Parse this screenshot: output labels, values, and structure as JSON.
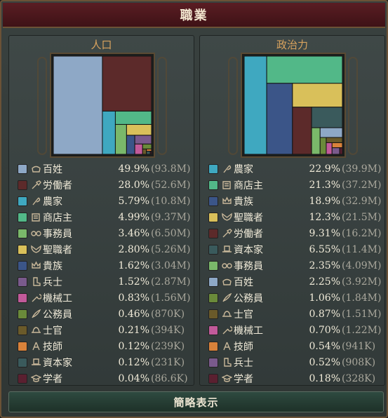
{
  "window": {
    "title": "職業"
  },
  "population": {
    "heading": "人口",
    "rows": [
      {
        "label": "百姓",
        "pct": "49.9%",
        "abs": "(93.8M)",
        "color": "#8ea8c6",
        "icon": "pot-icon"
      },
      {
        "label": "労働者",
        "pct": "28.0%",
        "abs": "(52.6M)",
        "color": "#5c2a2a",
        "icon": "shovel-icon"
      },
      {
        "label": "農家",
        "pct": "5.79%",
        "abs": "(10.8M)",
        "color": "#3fa8c0",
        "icon": "scythe-icon"
      },
      {
        "label": "商店主",
        "pct": "4.99%",
        "abs": "(9.37M)",
        "color": "#52b888",
        "icon": "ledger-icon"
      },
      {
        "label": "事務員",
        "pct": "3.46%",
        "abs": "(6.50M)",
        "color": "#7ab86a",
        "icon": "glasses-icon"
      },
      {
        "label": "聖職者",
        "pct": "2.80%",
        "abs": "(5.26M)",
        "color": "#d9c05a",
        "icon": "wings-icon"
      },
      {
        "label": "貴族",
        "pct": "1.62%",
        "abs": "(3.04M)",
        "color": "#3b5588",
        "icon": "crown-icon"
      },
      {
        "label": "兵士",
        "pct": "1.52%",
        "abs": "(2.87M)",
        "color": "#7a5a8c",
        "icon": "boot-icon"
      },
      {
        "label": "機械工",
        "pct": "0.83%",
        "abs": "(1.56M)",
        "color": "#c25a9a",
        "icon": "wrench-icon"
      },
      {
        "label": "公務員",
        "pct": "0.46%",
        "abs": "(870K)",
        "color": "#6a8a3a",
        "icon": "quill-icon"
      },
      {
        "label": "士官",
        "pct": "0.21%",
        "abs": "(394K)",
        "color": "#6a5a2a",
        "icon": "hat-icon"
      },
      {
        "label": "技師",
        "pct": "0.12%",
        "abs": "(239K)",
        "color": "#d9823a",
        "icon": "compass-icon"
      },
      {
        "label": "資本家",
        "pct": "0.12%",
        "abs": "(231K)",
        "color": "#3a5a5c",
        "icon": "tophat-icon"
      },
      {
        "label": "学者",
        "pct": "0.04%",
        "abs": "(86.6K)",
        "color": "#5a2030",
        "icon": "cap-icon"
      }
    ]
  },
  "political": {
    "heading": "政治力",
    "rows": [
      {
        "label": "農家",
        "pct": "22.9%",
        "abs": "(39.9M)",
        "color": "#3fa8c0",
        "icon": "scythe-icon"
      },
      {
        "label": "商店主",
        "pct": "21.3%",
        "abs": "(37.2M)",
        "color": "#52b888",
        "icon": "ledger-icon"
      },
      {
        "label": "貴族",
        "pct": "18.9%",
        "abs": "(32.9M)",
        "color": "#3b5588",
        "icon": "crown-icon"
      },
      {
        "label": "聖職者",
        "pct": "12.3%",
        "abs": "(21.5M)",
        "color": "#d9c05a",
        "icon": "wings-icon"
      },
      {
        "label": "労働者",
        "pct": "9.31%",
        "abs": "(16.2M)",
        "color": "#5c2a2a",
        "icon": "shovel-icon"
      },
      {
        "label": "資本家",
        "pct": "6.55%",
        "abs": "(11.4M)",
        "color": "#3a5a5c",
        "icon": "tophat-icon"
      },
      {
        "label": "事務員",
        "pct": "2.35%",
        "abs": "(4.09M)",
        "color": "#7ab86a",
        "icon": "glasses-icon"
      },
      {
        "label": "百姓",
        "pct": "2.25%",
        "abs": "(3.92M)",
        "color": "#8ea8c6",
        "icon": "pot-icon"
      },
      {
        "label": "公務員",
        "pct": "1.06%",
        "abs": "(1.84M)",
        "color": "#6a8a3a",
        "icon": "quill-icon"
      },
      {
        "label": "士官",
        "pct": "0.87%",
        "abs": "(1.51M)",
        "color": "#6a5a2a",
        "icon": "hat-icon"
      },
      {
        "label": "機械工",
        "pct": "0.70%",
        "abs": "(1.22M)",
        "color": "#c25a9a",
        "icon": "wrench-icon"
      },
      {
        "label": "技師",
        "pct": "0.54%",
        "abs": "(941K)",
        "color": "#d9823a",
        "icon": "compass-icon"
      },
      {
        "label": "兵士",
        "pct": "0.52%",
        "abs": "(908K)",
        "color": "#7a5a8c",
        "icon": "boot-icon"
      },
      {
        "label": "学者",
        "pct": "0.18%",
        "abs": "(328K)",
        "color": "#5a2030",
        "icon": "cap-icon"
      }
    ]
  },
  "footer": {
    "button_label": "簡略表示"
  }
}
